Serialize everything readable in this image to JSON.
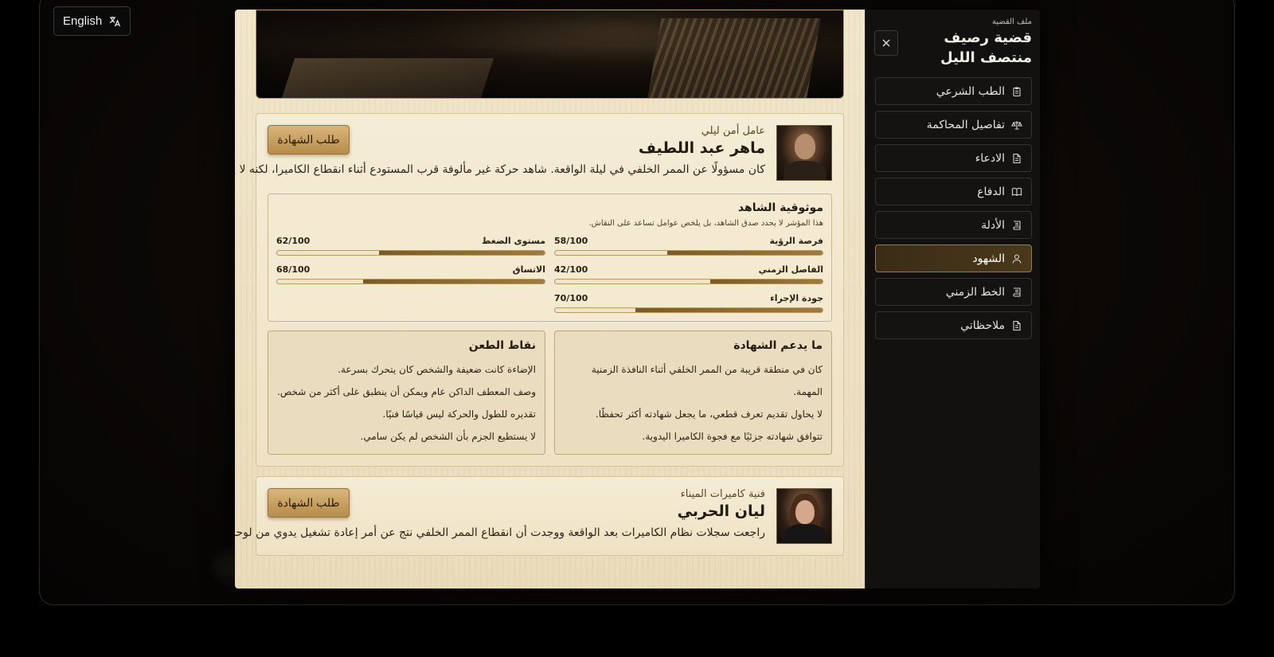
{
  "language_button": {
    "label": "English",
    "icon": "translate-icon"
  },
  "case": {
    "caption": "ملف القضية",
    "title": "قضية رصيف منتصف الليل"
  },
  "nav": [
    {
      "label": "الطب الشرعي",
      "icon": "clipboard-icon",
      "active": false
    },
    {
      "label": "تفاصيل المحاكمة",
      "icon": "scales-icon",
      "active": false
    },
    {
      "label": "الادعاء",
      "icon": "document-icon",
      "active": false
    },
    {
      "label": "الدفاع",
      "icon": "book-icon",
      "active": false
    },
    {
      "label": "الأدلة",
      "icon": "scroll-icon",
      "active": false
    },
    {
      "label": "الشهود",
      "icon": "user-icon",
      "active": true
    },
    {
      "label": "الخط الزمني",
      "icon": "scroll-icon",
      "active": false
    },
    {
      "label": "ملاحظاتي",
      "icon": "document-icon",
      "active": false
    }
  ],
  "witnesses": [
    {
      "role": "عامل أمن ليلي",
      "name": "ماهر عبد اللطيف",
      "bio": "كان مسؤولًا عن الممر الخلفي في ليلة الواقعة. شاهد حركة غير مألوفة قرب المستودع أثناء انقطاع الكاميرا، لكنه لا يدعي تعرفًا مؤكدًا.",
      "request_label": "طلب الشهادة",
      "reliability": {
        "title": "موثوقية الشاهد",
        "subtitle": "هذا المؤشر لا يحدد صدق الشاهد، بل يلخص عوامل تساعد على النقاش.",
        "metrics": [
          {
            "label": "فرصة الرؤية",
            "value": 58,
            "display": "58/100"
          },
          {
            "label": "مستوى الضغط",
            "value": 62,
            "display": "62/100"
          },
          {
            "label": "الفاصل الزمني",
            "value": 42,
            "display": "42/100"
          },
          {
            "label": "الاتساق",
            "value": 68,
            "display": "68/100"
          },
          {
            "label": "جودة الإجراء",
            "value": 70,
            "display": "70/100"
          }
        ]
      },
      "supports": {
        "title": "ما يدعم الشهادة",
        "items": [
          "كان في منطقة قريبة من الممر الخلفي أثناء النافذة الزمنية المهمة.",
          "لا يحاول تقديم تعرف قطعي، ما يجعل شهادته أكثر تحفظًا.",
          "تتوافق شهادته جزئيًا مع فجوة الكاميرا اليدوية."
        ]
      },
      "challenges": {
        "title": "نقاط الطعن",
        "items": [
          "الإضاءة كانت ضعيفة والشخص كان يتحرك بسرعة.",
          "وصف المعطف الداكن عام ويمكن أن ينطبق على أكثر من شخص.",
          "تقديره للطول والحركة ليس قياسًا فنيًا.",
          "لا يستطيع الجزم بأن الشخص لم يكن سامي."
        ]
      }
    },
    {
      "role": "فنية كاميرات الميناء",
      "name": "ليان الحربي",
      "bio": "راجعت سجلات نظام الكاميرات بعد الواقعة ووجدت أن انقطاع الممر الخلفي نتج عن أمر إعادة تشغيل يدوي من لوحة داخلية.",
      "request_label": "طلب الشهادة"
    }
  ]
}
